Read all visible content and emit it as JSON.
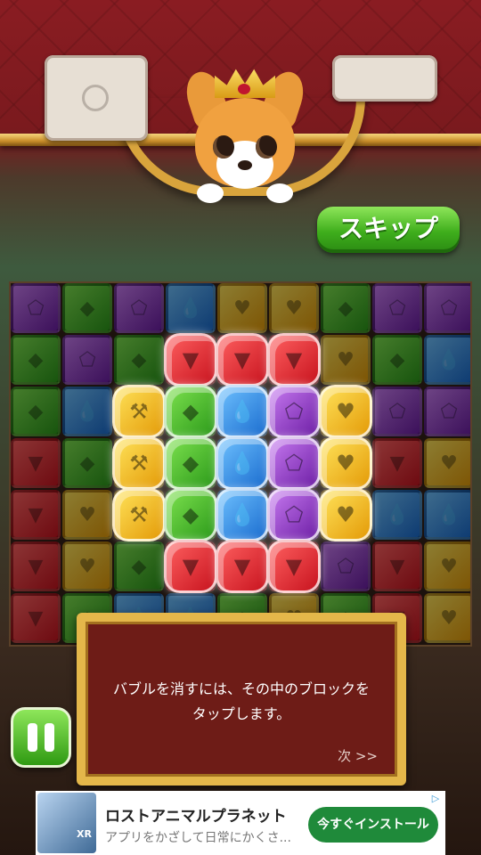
{
  "skip_button": {
    "label": "スキップ"
  },
  "board": {
    "colors": {
      "red": "#e0252f",
      "green": "#43b82a",
      "blue": "#2b8de6",
      "purple": "#8b35c4",
      "yellow": "#f4c31a"
    },
    "symbols": {
      "red": "▼",
      "green": "◆",
      "blue": "💧",
      "purple": "⬠",
      "yellow": "♥",
      "orange": "⚒"
    },
    "rows": [
      [
        "purple",
        "green",
        "purple",
        "blue",
        "yellow",
        "yellow",
        "green",
        "purple",
        "purple"
      ],
      [
        "green",
        "purple",
        "green",
        "red",
        "red",
        "red",
        "yellow",
        "green",
        "blue"
      ],
      [
        "green",
        "blue",
        "yellow",
        "green",
        "blue",
        "purple",
        "yellow",
        "purple",
        "purple"
      ],
      [
        "red",
        "green",
        "yellow",
        "green",
        "blue",
        "purple",
        "yellow",
        "red",
        "yellow"
      ],
      [
        "red",
        "yellow",
        "yellow",
        "green",
        "blue",
        "purple",
        "yellow",
        "blue",
        "blue"
      ],
      [
        "red",
        "yellow",
        "green",
        "red",
        "red",
        "red",
        "purple",
        "red",
        "yellow"
      ],
      [
        "red",
        "green",
        "blue",
        "blue",
        "green",
        "yellow",
        "green",
        "red",
        "yellow"
      ]
    ],
    "bubbles": [
      {
        "row": 1,
        "col": 3,
        "color": "red"
      },
      {
        "row": 1,
        "col": 4,
        "color": "red"
      },
      {
        "row": 1,
        "col": 5,
        "color": "red"
      },
      {
        "row": 2,
        "col": 2,
        "color": "yellow",
        "symbol": "orange"
      },
      {
        "row": 2,
        "col": 3,
        "color": "green"
      },
      {
        "row": 2,
        "col": 4,
        "color": "blue"
      },
      {
        "row": 2,
        "col": 5,
        "color": "purple"
      },
      {
        "row": 2,
        "col": 6,
        "color": "yellow"
      },
      {
        "row": 3,
        "col": 2,
        "color": "yellow",
        "symbol": "orange"
      },
      {
        "row": 3,
        "col": 3,
        "color": "green"
      },
      {
        "row": 3,
        "col": 4,
        "color": "blue"
      },
      {
        "row": 3,
        "col": 5,
        "color": "purple"
      },
      {
        "row": 3,
        "col": 6,
        "color": "yellow"
      },
      {
        "row": 4,
        "col": 2,
        "color": "yellow",
        "symbol": "orange"
      },
      {
        "row": 4,
        "col": 3,
        "color": "green"
      },
      {
        "row": 4,
        "col": 4,
        "color": "blue"
      },
      {
        "row": 4,
        "col": 5,
        "color": "purple"
      },
      {
        "row": 4,
        "col": 6,
        "color": "yellow"
      },
      {
        "row": 5,
        "col": 3,
        "color": "red"
      },
      {
        "row": 5,
        "col": 4,
        "color": "red"
      },
      {
        "row": 5,
        "col": 5,
        "color": "red"
      }
    ]
  },
  "tutorial": {
    "message": "バブルを消すには、その中のブロックを\nタップします。",
    "next_label": "次 >>"
  },
  "ad": {
    "badge": "XR",
    "title": "ロストアニマルプラネット",
    "subtitle": "アプリをかざして日常にかくさ...",
    "cta": "今すぐインストール",
    "adchoices_icon": "adchoices-icon"
  }
}
